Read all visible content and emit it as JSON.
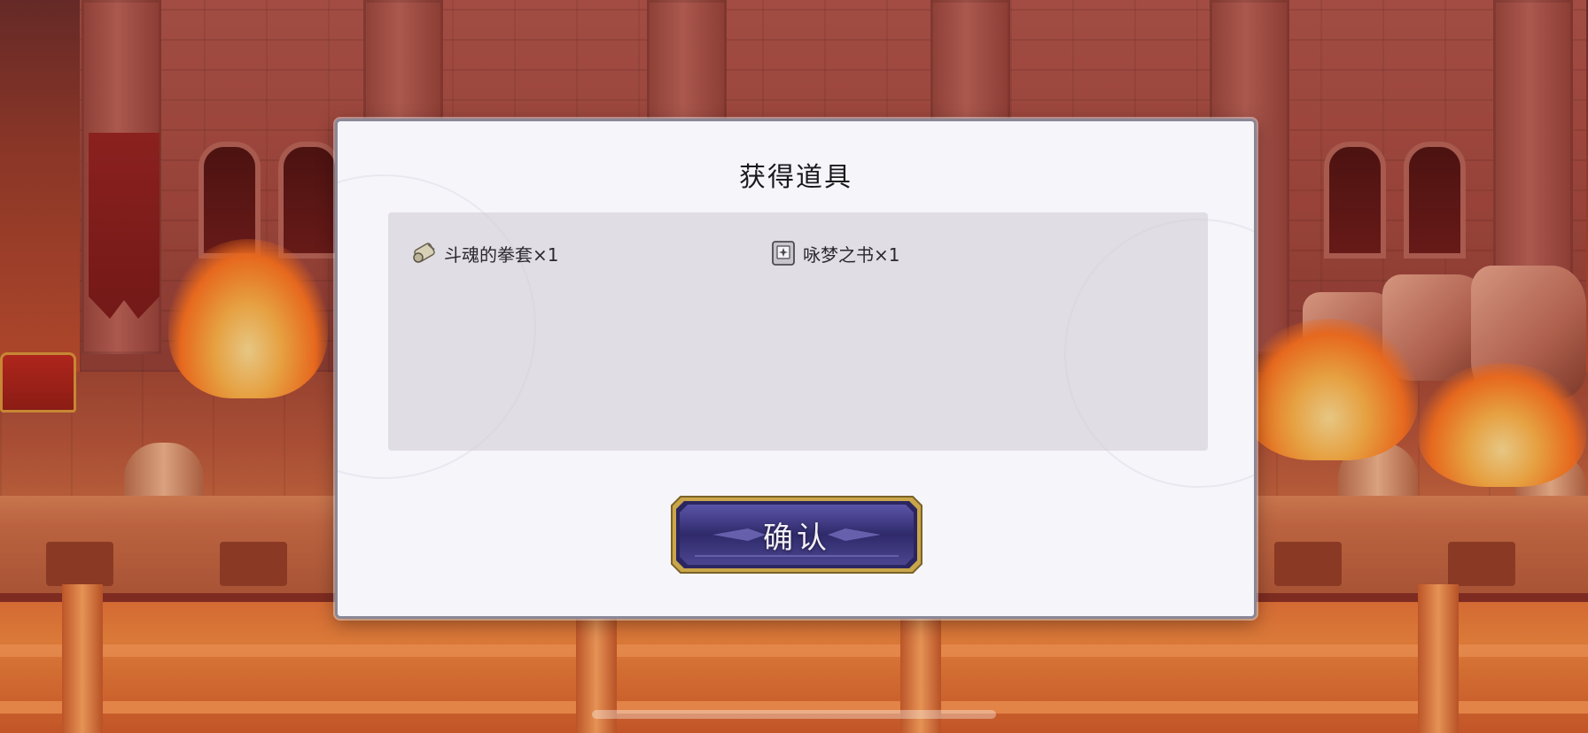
{
  "dialog": {
    "title": "获得道具",
    "items": [
      {
        "label": "斗魂的拳套×1",
        "icon": "gauntlet-scroll-icon"
      },
      {
        "label": "咏梦之书×1",
        "icon": "dream-book-icon"
      }
    ],
    "confirm_label": "确认"
  },
  "colors": {
    "dialog_bg": "#f6f5fa",
    "panel_bg": "#d2ced6",
    "button_fill": "#3b3478",
    "button_border": "#c9a64a"
  }
}
